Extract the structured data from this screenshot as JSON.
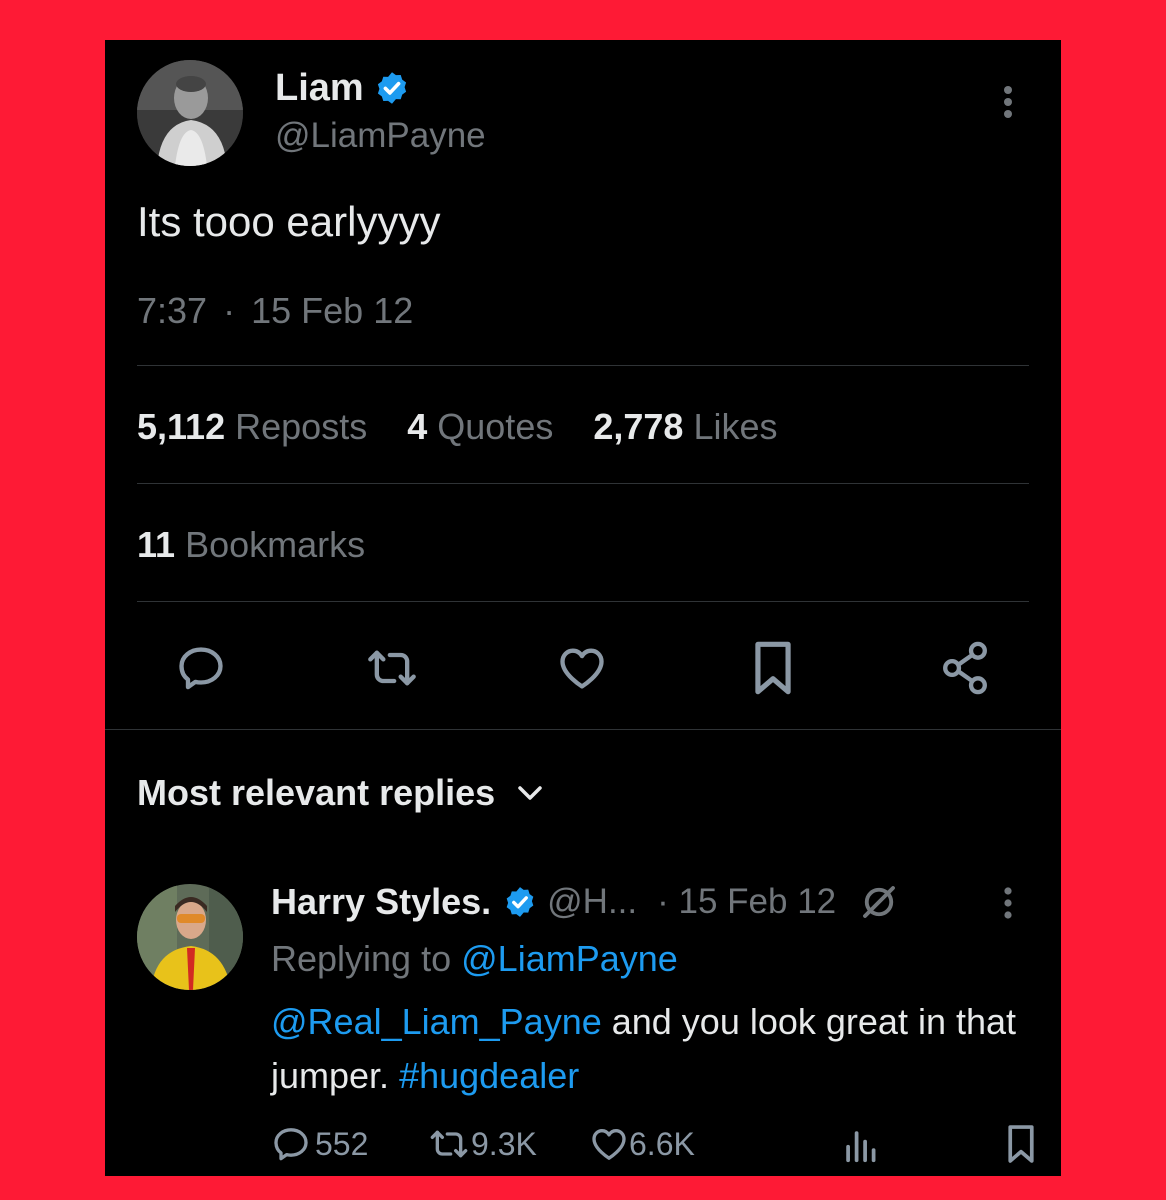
{
  "tweet": {
    "display_name": "Liam",
    "handle": "@LiamPayne",
    "text": "Its tooo earlyyyy",
    "time": "7:37",
    "separator": "·",
    "date": "15 Feb 12",
    "stats": {
      "reposts_count": "5,112",
      "reposts_label": "Reposts",
      "quotes_count": "4",
      "quotes_label": "Quotes",
      "likes_count": "2,778",
      "likes_label": "Likes",
      "bookmarks_count": "11",
      "bookmarks_label": "Bookmarks"
    }
  },
  "replies_filter": {
    "label": "Most relevant replies"
  },
  "reply": {
    "display_name": "Harry Styles.",
    "handle": "@H...",
    "date": "· 15 Feb 12",
    "replying_prefix": "Replying to",
    "replying_to": "@LiamPayne",
    "mention": "@Real_Liam_Payne",
    "text_part1": " and you look great in that jumper. ",
    "hashtag": "#hugdealer",
    "actions": {
      "replies": "552",
      "reposts": "9.3K",
      "likes": "6.6K"
    }
  },
  "colors": {
    "background_outer": "#fe1a35",
    "background": "#000000",
    "text": "#e7e9ea",
    "muted": "#71767b",
    "accent": "#1d9bf0",
    "divider": "#2f3336"
  },
  "icons": [
    "verified-badge-icon",
    "more-options-icon",
    "reply-icon",
    "repost-icon",
    "like-icon",
    "bookmark-icon",
    "share-icon",
    "chevron-down-icon",
    "grok-icon",
    "views-icon"
  ]
}
